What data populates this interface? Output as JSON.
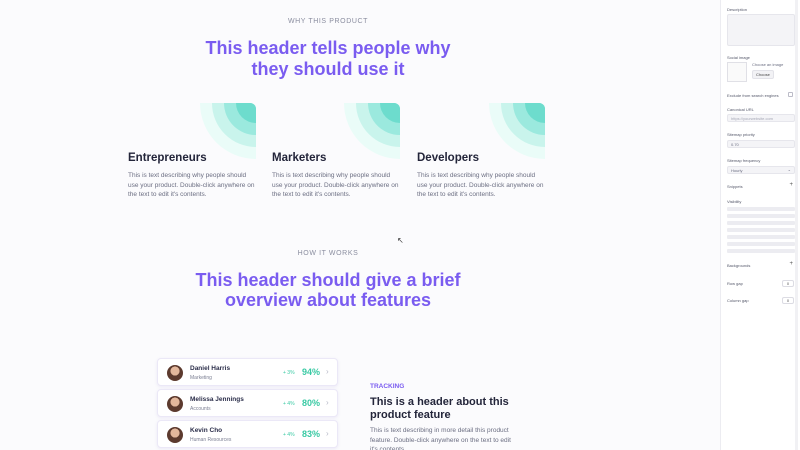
{
  "section1": {
    "eyebrow": "WHY THIS PRODUCT",
    "title_line1": "This header tells people why",
    "title_line2": "they should use it",
    "cards": [
      {
        "title": "Entrepreneurs",
        "text": "This is text describing why people should use your product. Double-click anywhere on the text to edit it's contents."
      },
      {
        "title": "Marketers",
        "text": "This is text describing why people should use your product. Double-click anywhere on the text to edit it's contents."
      },
      {
        "title": "Developers",
        "text": "This is text describing why people should use your product. Double-click anywhere on the text to edit it's contents."
      }
    ]
  },
  "section2": {
    "eyebrow": "HOW IT WORKS",
    "title_line1": "This header should give a brief",
    "title_line2": "overview about features"
  },
  "people": [
    {
      "name": "Daniel Harris",
      "role": "Marketing",
      "delta": "+ 3%",
      "pct": "94%"
    },
    {
      "name": "Melissa Jennings",
      "role": "Accounts",
      "delta": "+ 4%",
      "pct": "80%"
    },
    {
      "name": "Kevin Cho",
      "role": "Human Resources",
      "delta": "+ 4%",
      "pct": "83%"
    }
  ],
  "feature": {
    "eyebrow": "TRACKING",
    "title": "This is a header about this product feature",
    "text": "This is text describing in more detail this product feature. Double-click anywhere on the text to edit it's contents."
  },
  "panel": {
    "description_label": "Description",
    "social_image_label": "Social image",
    "choose_image_label": "Choose an image",
    "choose_button": "Choose",
    "exclude_label": "Exclude from search engines",
    "canonical_label": "Canonical URL",
    "canonical_placeholder": "https://yourwebsite.com",
    "sitemap_priority_label": "Sitemap priority",
    "sitemap_priority_value": "0.70",
    "sitemap_frequency_label": "Sitemap frequency",
    "sitemap_frequency_value": "Hourly",
    "snippets_label": "Snippets",
    "visibility_label": "Visibility",
    "backgrounds_label": "Backgrounds",
    "row_gap_label": "Row gap",
    "row_gap_value": "0",
    "column_gap_label": "Column gap",
    "column_gap_value": "0"
  },
  "colors": {
    "accent": "#7a5cf0",
    "teal": "#38c9a3"
  }
}
